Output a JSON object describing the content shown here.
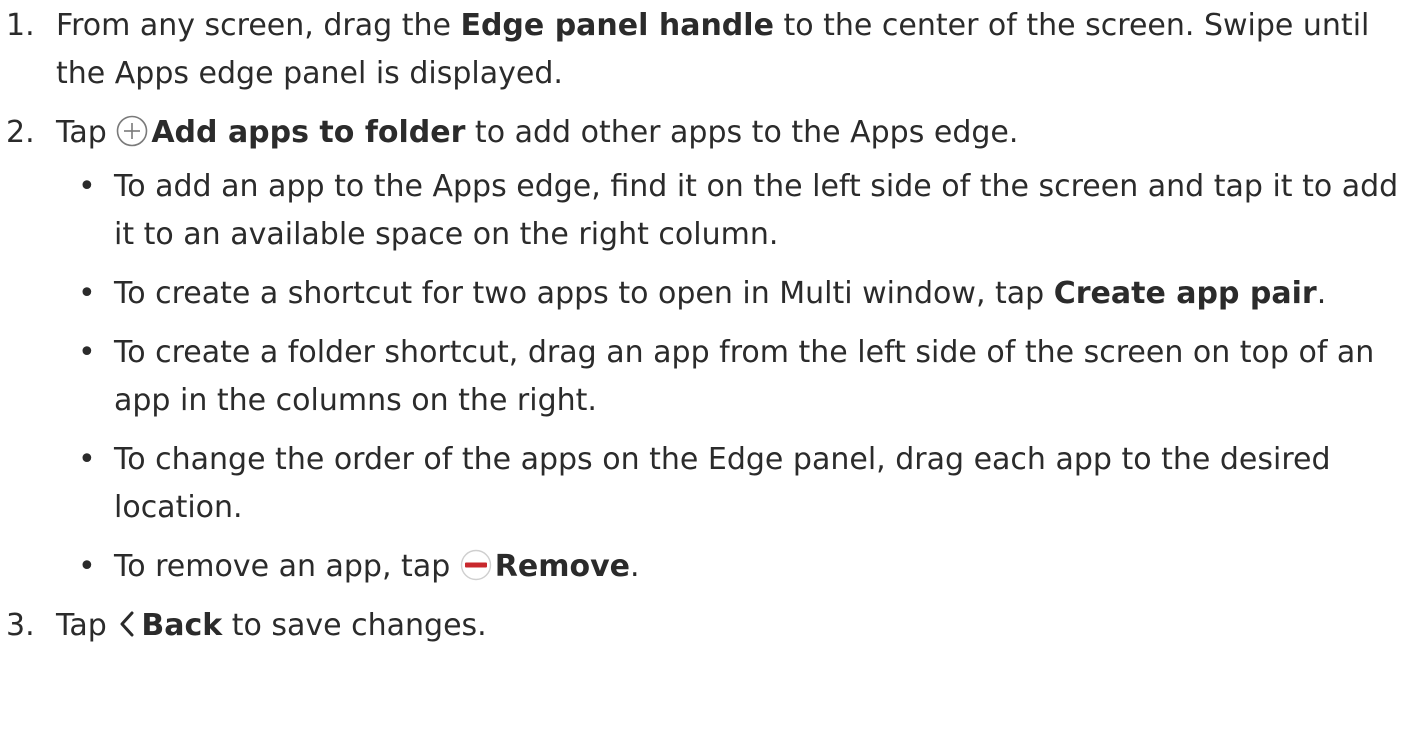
{
  "steps": [
    {
      "number": "1.",
      "pre": "From any screen, drag the ",
      "bold": "Edge panel handle",
      "post": " to the center of the screen. Swipe until the Apps edge panel is displayed."
    },
    {
      "number": "2.",
      "pre": "Tap ",
      "icon": "plus-circle-icon",
      "bold": "Add apps to folder",
      "post": " to add other apps to the Apps edge.",
      "bullets": [
        {
          "text": "To add an app to the Apps edge, find it on the left side of the screen and tap it to add it to an available space on the right column."
        },
        {
          "pre": "To create a shortcut for two apps to open in Multi window, tap ",
          "bold": "Create app pair",
          "post": "."
        },
        {
          "text": "To create a folder shortcut, drag an app from the left side of the screen on top of an app in the columns on the right."
        },
        {
          "text": "To change the order of the apps on the Edge panel, drag each app to the desired location."
        },
        {
          "pre": "To remove an app, tap ",
          "icon": "remove-minus-icon",
          "bold": "Remove",
          "post": "."
        }
      ]
    },
    {
      "number": "3.",
      "pre": "Tap ",
      "icon": "back-chevron-icon",
      "bold": "Back",
      "post": " to save changes."
    }
  ],
  "bullet_glyph": "•",
  "colors": {
    "text": "#2b2b2b",
    "remove_icon_red": "#c8282d",
    "icon_outline": "#7a7a7a"
  }
}
